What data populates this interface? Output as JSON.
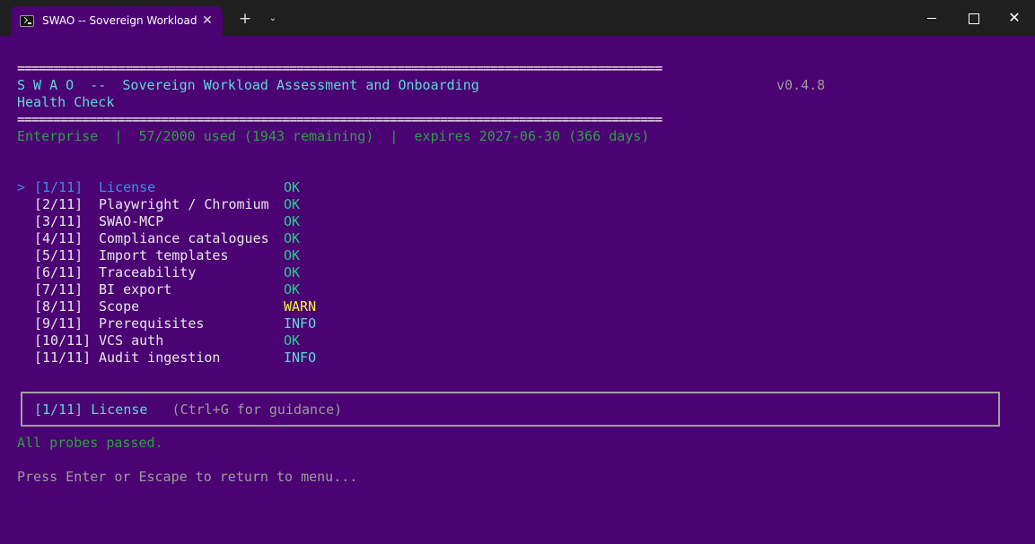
{
  "window": {
    "tab_title": "SWAO -- Sovereign Workload",
    "tab_close": "✕",
    "new_tab": "+",
    "dropdown": "⌄",
    "close": "✕"
  },
  "header": {
    "rule": "==========================================================================================",
    "title": "S W A O  --  Sovereign Workload Assessment and Onboarding",
    "version": "v0.4.8",
    "subtitle": "Health Check"
  },
  "license_line": {
    "tier": "Enterprise",
    "sep1": "  |  ",
    "usage": "57/2000 used (1943 remaining)",
    "sep2": "  |  ",
    "expiry": "expires 2027-06-30 (366 days)"
  },
  "checks": [
    {
      "cursor": ">",
      "index": "[1/11]",
      "name": "License",
      "status": "OK",
      "selected": true
    },
    {
      "cursor": "",
      "index": "[2/11]",
      "name": "Playwright / Chromium",
      "status": "OK"
    },
    {
      "cursor": "",
      "index": "[3/11]",
      "name": "SWAO-MCP",
      "status": "OK"
    },
    {
      "cursor": "",
      "index": "[4/11]",
      "name": "Compliance catalogues",
      "status": "OK"
    },
    {
      "cursor": "",
      "index": "[5/11]",
      "name": "Import templates",
      "status": "OK"
    },
    {
      "cursor": "",
      "index": "[6/11]",
      "name": "Traceability",
      "status": "OK"
    },
    {
      "cursor": "",
      "index": "[7/11]",
      "name": "BI export",
      "status": "OK"
    },
    {
      "cursor": "",
      "index": "[8/11]",
      "name": "Scope",
      "status": "WARN"
    },
    {
      "cursor": "",
      "index": "[9/11]",
      "name": "Prerequisites",
      "status": "INFO"
    },
    {
      "cursor": "",
      "index": "[10/11]",
      "name": "VCS auth",
      "status": "OK"
    },
    {
      "cursor": "",
      "index": "[11/11]",
      "name": "Audit ingestion",
      "status": "INFO"
    }
  ],
  "status_box": {
    "index": "[1/11]",
    "name": "License",
    "hint_open": "(",
    "hint_key": "Ctrl+G",
    "hint_rest": " for guidance)"
  },
  "summary": "All probes passed.",
  "prompt": "Press Enter or Escape to return to menu...",
  "colors": {
    "background": "#4b0374",
    "ok": "#23d18b",
    "warn": "#f5f543",
    "info": "#61d6d6",
    "selected": "#3b8eea"
  }
}
